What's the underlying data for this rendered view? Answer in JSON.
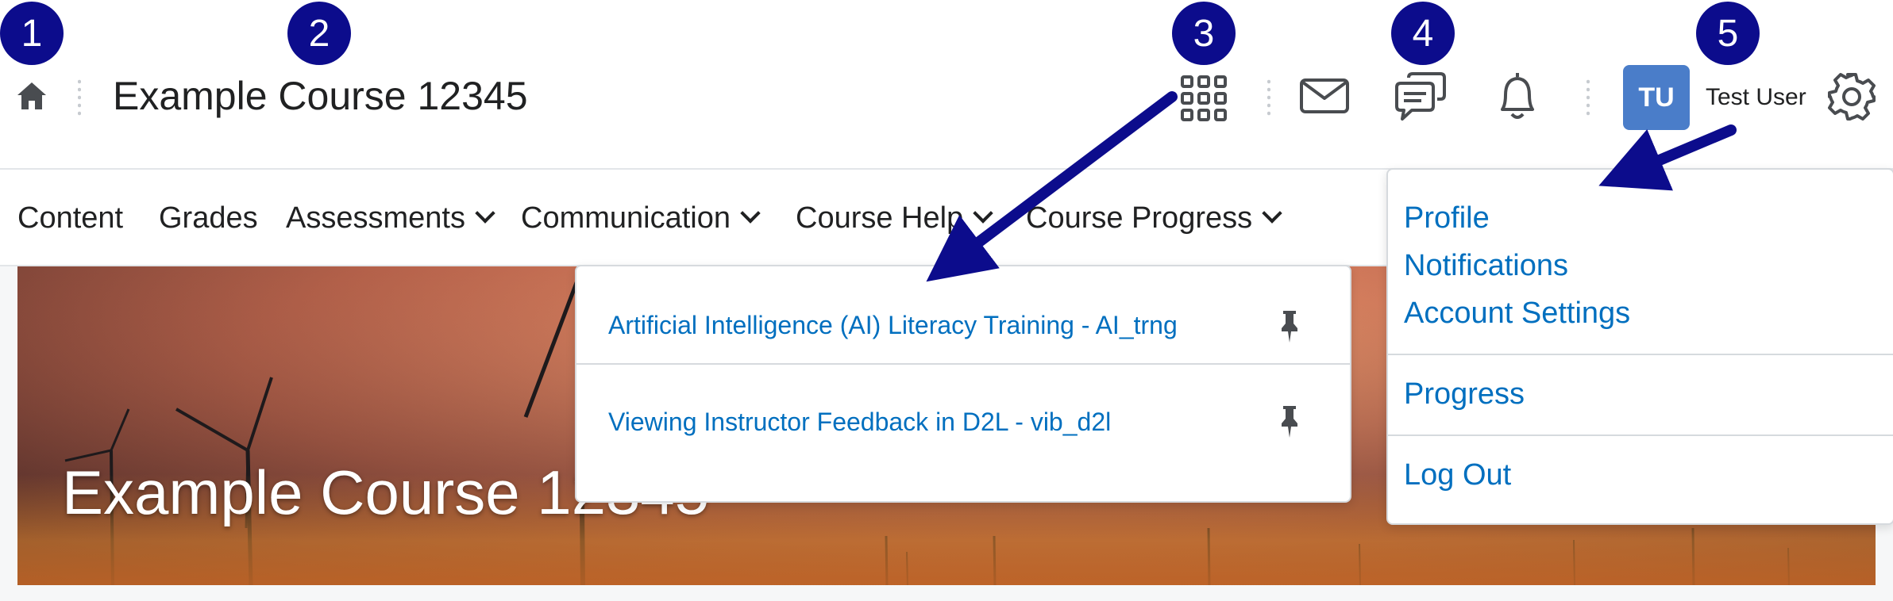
{
  "header": {
    "course_title": "Example Course 12345",
    "user_initials": "TU",
    "user_name": "Test User"
  },
  "icons": [
    "home-icon",
    "waffle-grid-icon",
    "mail-icon",
    "chat-icon",
    "bell-icon",
    "gear-icon",
    "pin-icon"
  ],
  "nav": {
    "items": [
      {
        "label": "Content",
        "has_dropdown": false
      },
      {
        "label": "Grades",
        "has_dropdown": false
      },
      {
        "label": "Assessments",
        "has_dropdown": true
      },
      {
        "label": "Communication",
        "has_dropdown": true
      },
      {
        "label": "Course Help",
        "has_dropdown": true
      },
      {
        "label": "Course Progress",
        "has_dropdown": true
      }
    ]
  },
  "banner": {
    "title": "Example Course 12345"
  },
  "course_menu": {
    "items": [
      {
        "label": "Artificial Intelligence (AI) Literacy Training - AI_trng",
        "pinned": true
      },
      {
        "label": "Viewing Instructor Feedback in D2L - vib_d2l",
        "pinned": true
      }
    ]
  },
  "user_menu": {
    "items": [
      {
        "label": "Profile"
      },
      {
        "label": "Notifications"
      },
      {
        "label": "Account Settings"
      },
      {
        "label": "Progress"
      },
      {
        "label": "Log Out"
      }
    ]
  },
  "callouts": [
    "1",
    "2",
    "3",
    "4",
    "5"
  ],
  "colors": {
    "link": "#006fbf",
    "callout": "#0c0c8c",
    "avatar": "#4a7dc9",
    "text": "#202122"
  }
}
